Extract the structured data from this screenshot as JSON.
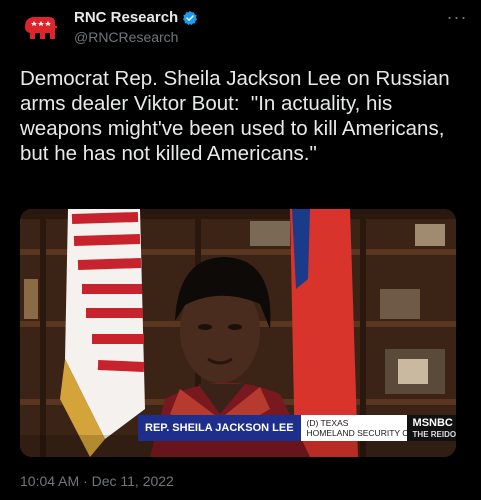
{
  "author": {
    "display_name": "RNC Research",
    "handle": "@RNCResearch",
    "verified": true,
    "avatar_icon": "republican-elephant-icon"
  },
  "tweet": {
    "text": "Democrat Rep. Sheila Jackson Lee on Russian arms dealer Viktor Bout:  \"In actuality, his weapons might've been used to kill Americans, but he has not killed Americans.\"",
    "timestamp": "10:04 AM · Dec 11, 2022"
  },
  "media": {
    "chyron_name": "REP. SHEILA JACKSON LEE",
    "chyron_line1": "(D) TEXAS",
    "chyron_line2": "HOMELAND SECURITY CMTE.",
    "network": "MSNBC",
    "show": "THE REIDOUT"
  },
  "colors": {
    "accent": "#1d9bf0",
    "elephant": "#e0242b",
    "chyron_blue": "#1e2e8c"
  }
}
